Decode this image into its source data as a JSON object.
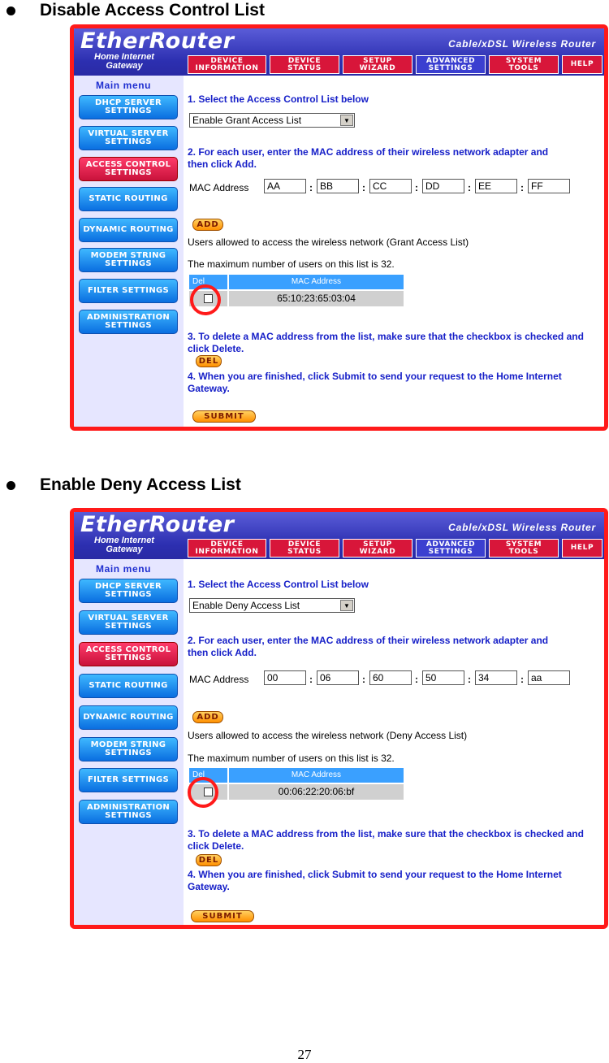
{
  "sections": [
    {
      "heading": "Disable Access Control List",
      "screen": {
        "brand": "EtherRouter",
        "subbrand": "Home Internet Gateway",
        "router_title": "Cable/xDSL Wireless Router",
        "nav": [
          "DEVICE INFORMATION",
          "DEVICE STATUS",
          "SETUP WIZARD",
          "ADVANCED SETTINGS",
          "SYSTEM TOOLS",
          "HELP"
        ],
        "main_menu": "Main menu",
        "side_items": [
          "DHCP SERVER SETTINGS",
          "VIRTUAL SERVER SETTINGS",
          "ACCESS CONTROL SETTINGS",
          "STATIC ROUTING",
          "DYNAMIC ROUTING",
          "MODEM STRING SETTINGS",
          "FILTER SETTINGS",
          "ADMINISTRATION SETTINGS"
        ],
        "step1": "1. Select the Access Control List below",
        "select_value": "Enable Grant Access List",
        "step2": "2. For each user, enter the MAC address of their wireless network adapter and then click Add.",
        "mac_label": "MAC Address",
        "mac_values": [
          "AA",
          "BB",
          "CC",
          "DD",
          "EE",
          "FF"
        ],
        "add_label": "ADD",
        "users_text": "Users allowed to access the wireless network (Grant Access List)",
        "max_text": "The maximum number of users on this list is 32.",
        "table_del": "Del",
        "table_mac": "MAC Address",
        "table_row": "65:10:23:65:03:04",
        "step3": "3. To delete a MAC address from the list, make sure that the checkbox is checked and click Delete.",
        "del_label": "DEL",
        "step4": "4. When you are finished, click Submit to send your request to the Home Internet Gateway.",
        "submit_label": "SUBMIT"
      }
    },
    {
      "heading": "Enable Deny Access List",
      "screen": {
        "brand": "EtherRouter",
        "subbrand": "Home Internet Gateway",
        "router_title": "Cable/xDSL Wireless Router",
        "nav": [
          "DEVICE INFORMATION",
          "DEVICE STATUS",
          "SETUP WIZARD",
          "ADVANCED SETTINGS",
          "SYSTEM TOOLS",
          "HELP"
        ],
        "main_menu": "Main menu",
        "side_items": [
          "DHCP SERVER SETTINGS",
          "VIRTUAL SERVER SETTINGS",
          "ACCESS CONTROL SETTINGS",
          "STATIC ROUTING",
          "DYNAMIC ROUTING",
          "MODEM STRING SETTINGS",
          "FILTER SETTINGS",
          "ADMINISTRATION SETTINGS"
        ],
        "step1": "1. Select the Access Control List below",
        "select_value": "Enable Deny Access List",
        "step2": "2. For each user, enter the MAC address of their wireless network adapter and then click Add.",
        "mac_label": "MAC Address",
        "mac_values": [
          "00",
          "06",
          "60",
          "50",
          "34",
          "aa"
        ],
        "add_label": "ADD",
        "users_text": "Users allowed to access the wireless network (Deny Access List)",
        "max_text": "The maximum number of users on this list is 32.",
        "table_del": "Del",
        "table_mac": "MAC Address",
        "table_row": "00:06:22:20:06:bf",
        "step3": "3. To delete a MAC address from the list, make sure that the checkbox is checked and click Delete.",
        "del_label": "DEL",
        "step4": "4. When you are finished, click Submit to send your request to the Home Internet Gateway.",
        "submit_label": "SUBMIT"
      }
    }
  ],
  "page_number": "27",
  "colors": {
    "highlight": "#ff1a1a",
    "banner": "#2c2fb0",
    "step_text": "#1720c8"
  }
}
